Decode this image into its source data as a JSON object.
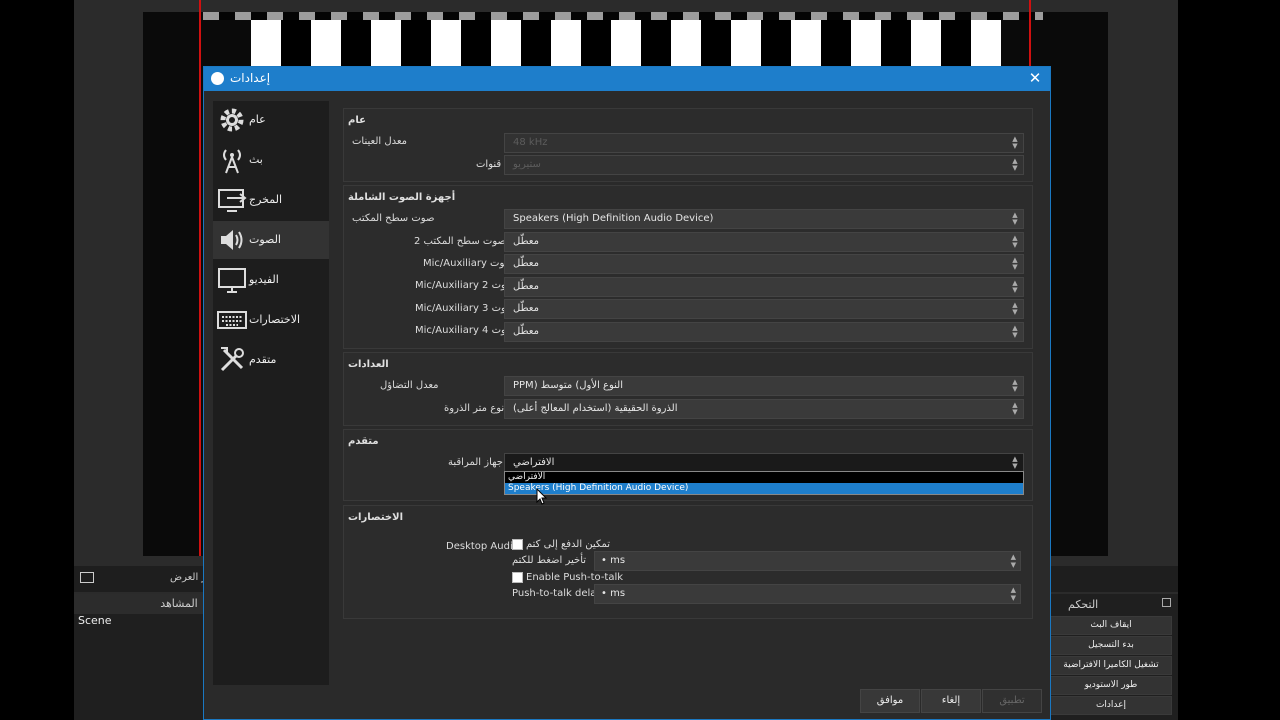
{
  "background": {
    "scenes_header": "المشاهد",
    "scene_item": "Scene",
    "preview_label": "ر العرض",
    "controls_header": "التحكم",
    "controls": [
      "ايقاف البث",
      "بدء التسجيل",
      "تشغيل الكاميرا الافتراضية",
      "طور الاستوديو",
      "إعدادات"
    ]
  },
  "dialog": {
    "title": "إعدادات",
    "close_glyph": "✕"
  },
  "sidebar": {
    "items": [
      {
        "label": "عام",
        "icon": "gear-icon"
      },
      {
        "label": "بث",
        "icon": "antenna-icon"
      },
      {
        "label": "المخرج",
        "icon": "output-icon"
      },
      {
        "label": "الصوت",
        "icon": "speaker-icon",
        "active": true
      },
      {
        "label": "الفيديو",
        "icon": "monitor-icon"
      },
      {
        "label": "الاختصارات",
        "icon": "keyboard-icon"
      },
      {
        "label": "متقدم",
        "icon": "tools-icon"
      }
    ]
  },
  "general": {
    "title": "عام",
    "sample_rate_label": "معدل العينات",
    "sample_rate_value": "48 kHz",
    "channels_label": "قنوات",
    "channels_value": "ستيريو"
  },
  "global_audio": {
    "title": "أجهزة الصوت الشاملة",
    "rows": [
      {
        "label": "صوت سطح المكتب",
        "value": "Speakers (High Definition Audio Device)"
      },
      {
        "label": "صوت سطح المكتب 2",
        "value": "معطّل"
      },
      {
        "label": "Mic/Auxiliary صوت",
        "value": "معطّل"
      },
      {
        "label": "Mic/Auxiliary 2 صوت",
        "value": "معطّل"
      },
      {
        "label": "Mic/Auxiliary 3 صوت",
        "value": "معطّل"
      },
      {
        "label": "Mic/Auxiliary 4 صوت",
        "value": "معطّل"
      }
    ]
  },
  "meters": {
    "title": "العدادات",
    "decay_label": "معدل التضاؤل",
    "decay_value": "PPM) النوع الأول) متوسط",
    "peak_label": "نوع متر الذروة",
    "peak_value": "الذروة الحقيقية (استخدام المعالج أعلى)"
  },
  "advanced": {
    "title": "متقدم",
    "monitor_label": "جهاز المراقبة",
    "monitor_value": "الافتراضي",
    "dropdown_options": [
      "الافتراضي",
      "Speakers (High Definition Audio Device)"
    ],
    "selected_index": 1
  },
  "hotkeys": {
    "title": "الاختصارات",
    "source_label": "Desktop Audio",
    "push_to_mute_label": "تمكين الدفع إلى كتم",
    "push_to_mute_delay_label": "تأخير اضغط للكتم",
    "push_to_mute_delay_value": "• ms",
    "push_to_talk_label": "Enable Push-to-talk",
    "push_to_talk_delay_label": "Push-to-talk delay",
    "push_to_talk_delay_value": "• ms"
  },
  "footer": {
    "ok": "موافق",
    "cancel": "إلغاء",
    "apply": "تطبيق"
  }
}
